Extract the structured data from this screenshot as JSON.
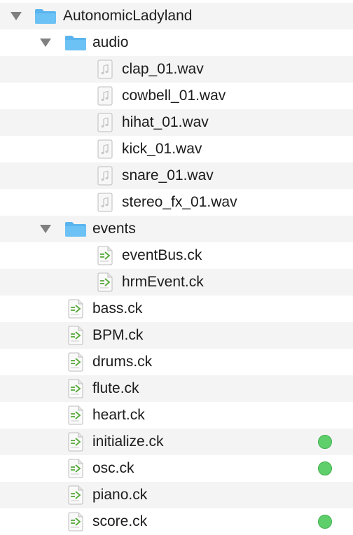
{
  "tree": {
    "root": {
      "label": "AutonomicLadyland",
      "icon": "folder-icon",
      "expanded": true
    },
    "folders": [
      {
        "label": "audio",
        "icon": "folder-icon",
        "expanded": true,
        "children": [
          {
            "label": "clap_01.wav",
            "icon": "audio-file-icon"
          },
          {
            "label": "cowbell_01.wav",
            "icon": "audio-file-icon"
          },
          {
            "label": "hihat_01.wav",
            "icon": "audio-file-icon"
          },
          {
            "label": "kick_01.wav",
            "icon": "audio-file-icon"
          },
          {
            "label": "snare_01.wav",
            "icon": "audio-file-icon"
          },
          {
            "label": "stereo_fx_01.wav",
            "icon": "audio-file-icon"
          }
        ]
      },
      {
        "label": "events",
        "icon": "folder-icon",
        "expanded": true,
        "children": [
          {
            "label": "eventBus.ck",
            "icon": "chuck-file-icon"
          },
          {
            "label": "hrmEvent.ck",
            "icon": "chuck-file-icon"
          }
        ]
      }
    ],
    "files": [
      {
        "label": "bass.ck",
        "icon": "chuck-file-icon",
        "status": null
      },
      {
        "label": "BPM.ck",
        "icon": "chuck-file-icon",
        "status": null
      },
      {
        "label": "drums.ck",
        "icon": "chuck-file-icon",
        "status": null
      },
      {
        "label": "flute.ck",
        "icon": "chuck-file-icon",
        "status": null
      },
      {
        "label": "heart.ck",
        "icon": "chuck-file-icon",
        "status": null
      },
      {
        "label": "initialize.ck",
        "icon": "chuck-file-icon",
        "status": "green"
      },
      {
        "label": "osc.ck",
        "icon": "chuck-file-icon",
        "status": "green"
      },
      {
        "label": "piano.ck",
        "icon": "chuck-file-icon",
        "status": null
      },
      {
        "label": "score.ck",
        "icon": "chuck-file-icon",
        "status": "green"
      }
    ]
  },
  "colors": {
    "folder": "#5ab4ee",
    "status_dot": "#5fcf6b",
    "alt_row": "#f4f4f4"
  }
}
